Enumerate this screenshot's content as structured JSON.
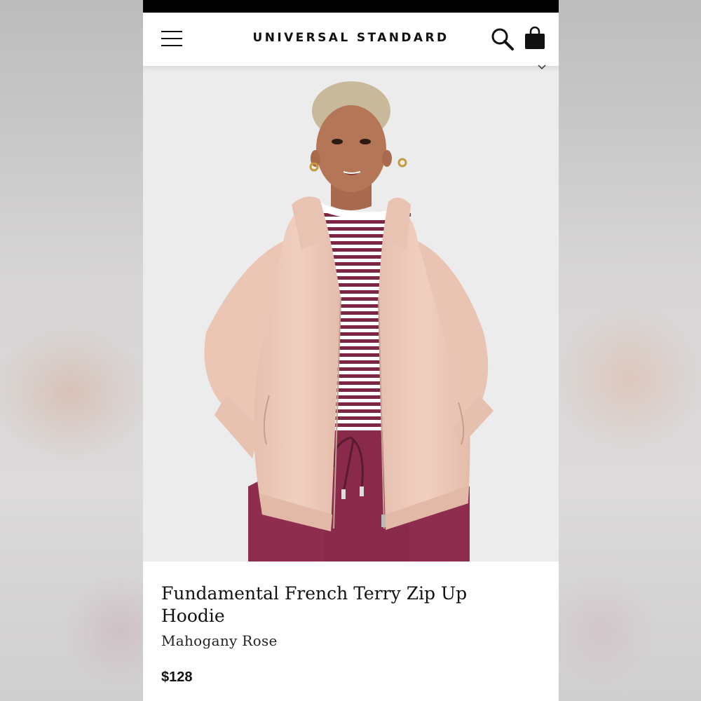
{
  "brand": {
    "name": "UNIVERSAL STANDARD"
  },
  "header": {
    "menu_icon": "hamburger-menu-icon",
    "search_icon": "search-icon",
    "bag_icon": "shopping-bag-icon",
    "dropdown_icon": "chevron-down-icon"
  },
  "product": {
    "image_alt": "",
    "title": "Fundamental French Terry Zip Up Hoodie",
    "color": "Mahogany Rose",
    "price": "$128"
  },
  "colors": {
    "hoodie": "#eecbbc",
    "pants": "#8e2d4e",
    "stripe": "#7d2545",
    "background": "#ececec"
  }
}
